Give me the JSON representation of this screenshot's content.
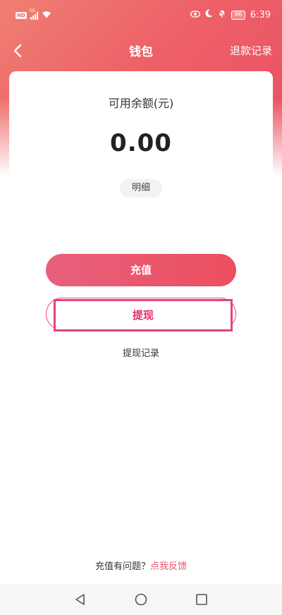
{
  "status_bar": {
    "hd_badge": "HD",
    "network": "5G",
    "battery": "96",
    "time": "6:39"
  },
  "nav": {
    "title": "钱包",
    "right_link": "退款记录"
  },
  "balance": {
    "label": "可用余额(元)",
    "value": "0.00",
    "detail_label": "明细"
  },
  "actions": {
    "recharge_label": "充值",
    "withdraw_label": "提现",
    "withdraw_record_label": "提现记录"
  },
  "footer": {
    "question_text": "充值有问题？",
    "feedback_link": "点我反馈"
  },
  "colors": {
    "accent": "#e8546b",
    "header_gradient_start": "#ef7f72",
    "header_gradient_end": "#e94e63",
    "highlight_border": "#e0457a"
  },
  "icons": {
    "back": "chevron-left-icon",
    "eye": "eye-icon",
    "moon": "moon-icon",
    "mute": "bell-off-icon",
    "wifi": "wifi-icon"
  }
}
